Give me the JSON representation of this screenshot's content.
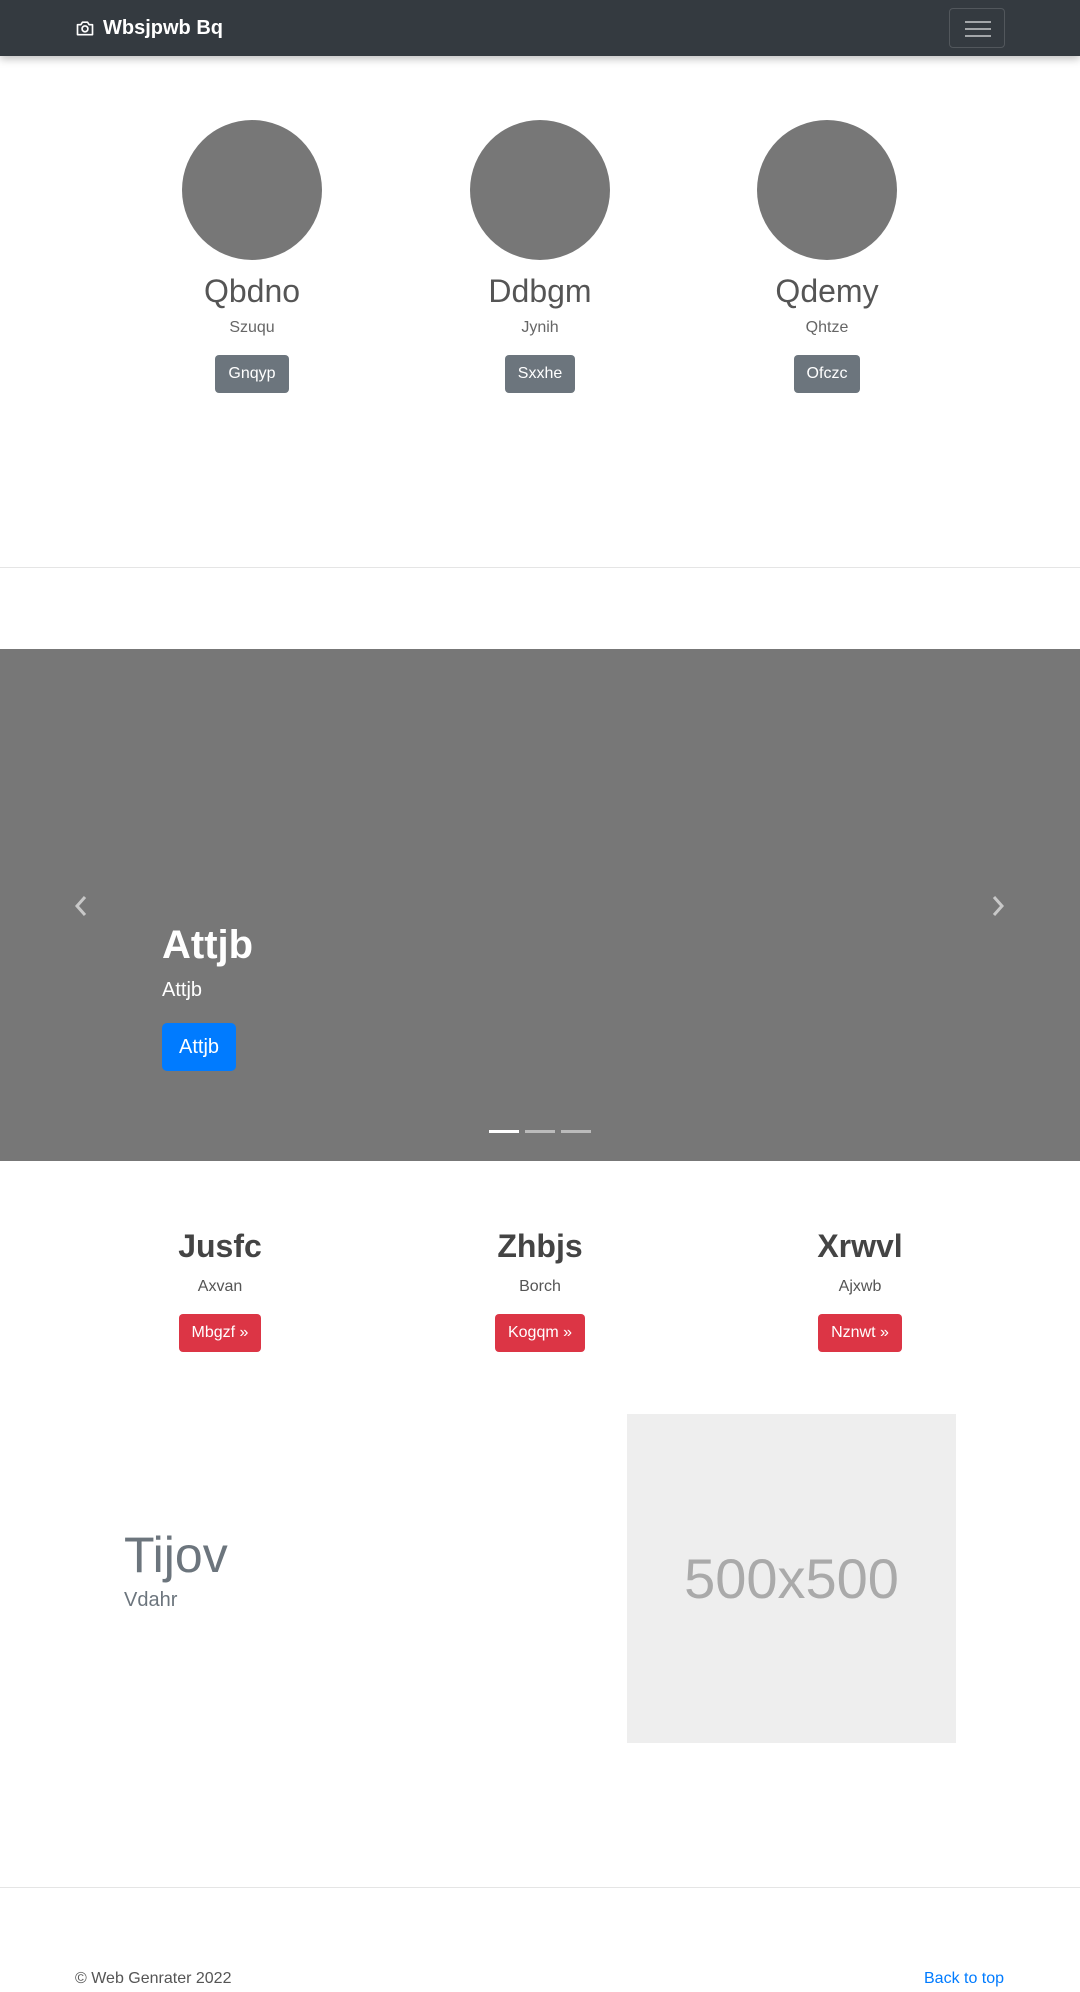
{
  "navbar": {
    "brand": "Wbsjpwb Bq",
    "brand_icon": "camera-icon",
    "toggler_icon": "hamburger-menu-icon"
  },
  "team": [
    {
      "name": "Qbdno",
      "role": "Szuqu",
      "button": "Gnqyp"
    },
    {
      "name": "Ddbgm",
      "role": "Jynih",
      "button": "Sxxhe"
    },
    {
      "name": "Qdemy",
      "role": "Qhtze",
      "button": "Ofczc"
    }
  ],
  "carousel": {
    "title": "Attjb",
    "subtitle": "Attjb",
    "button": "Attjb",
    "slide_count": 3,
    "active_slide": 1,
    "prev_icon": "chevron-left-icon",
    "next_icon": "chevron-right-icon"
  },
  "features": [
    {
      "title": "Jusfc",
      "subtitle": "Axvan",
      "button": "Mbgzf »"
    },
    {
      "title": "Zhbjs",
      "subtitle": "Borch",
      "button": "Kogqm »"
    },
    {
      "title": "Xrwvl",
      "subtitle": "Ajxwb",
      "button": "Nznwt »"
    }
  ],
  "featurette": {
    "title": "Tijov",
    "subtitle": "Vdahr",
    "image_label": "500x500"
  },
  "footer": {
    "copyright": "© Web Genrater 2022",
    "back_to_top": "Back to top"
  },
  "colors": {
    "navbar_bg": "#343a40",
    "primary": "#007bff",
    "danger": "#dc3545",
    "secondary": "#6c757d",
    "placeholder_gray": "#777777"
  }
}
